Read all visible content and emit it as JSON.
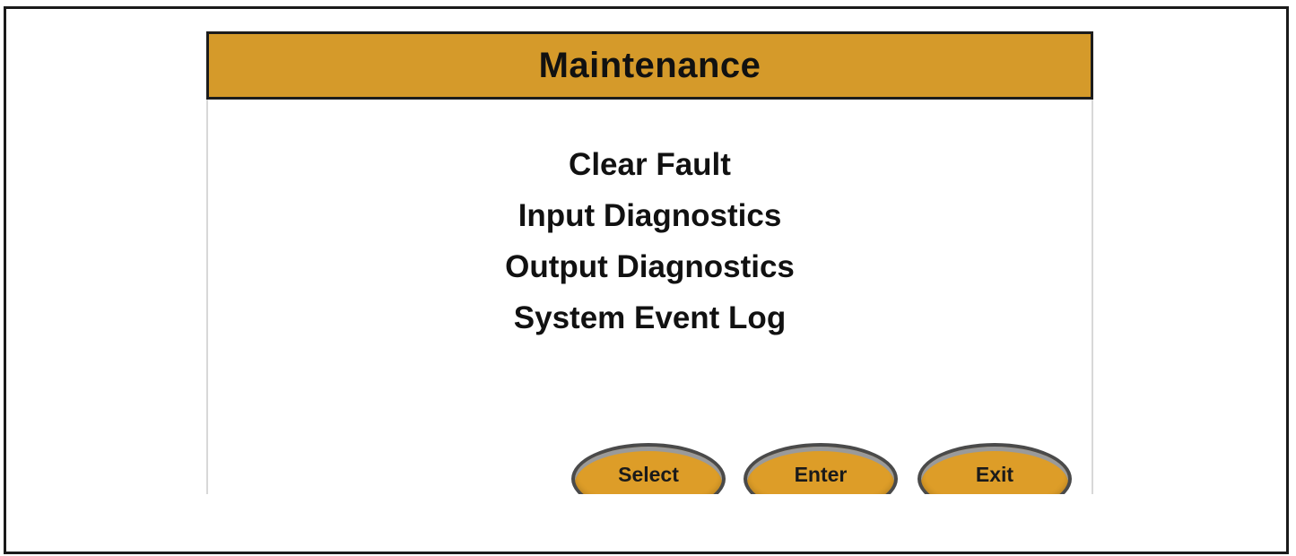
{
  "screen": {
    "title": "Maintenance",
    "accent_color": "#d59a2a"
  },
  "menu": {
    "items": [
      {
        "label": "Clear Fault"
      },
      {
        "label": "Input Diagnostics"
      },
      {
        "label": "Output Diagnostics"
      },
      {
        "label": "System Event Log"
      }
    ]
  },
  "soft_keys": {
    "select_label": "Select",
    "enter_label": "Enter",
    "exit_label": "Exit"
  }
}
